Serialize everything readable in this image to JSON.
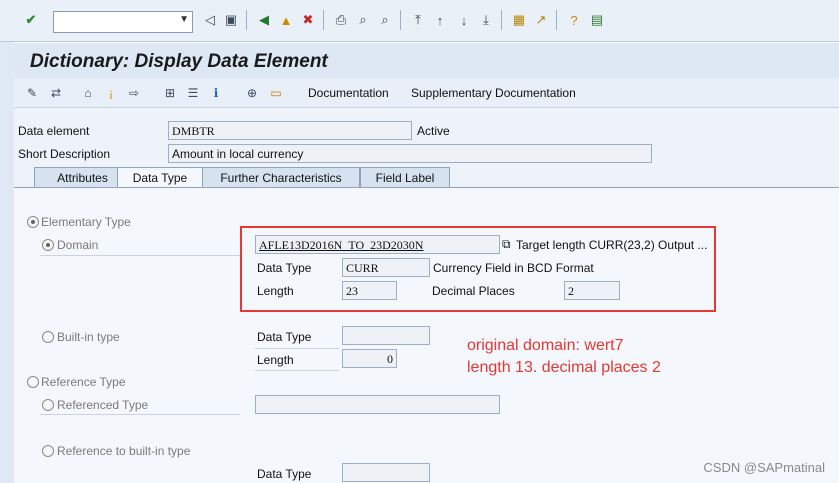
{
  "toolbar": {
    "icons": [
      "enter-icon",
      "back-icon",
      "save-icon",
      "nav-back-icon",
      "nav-exit-icon",
      "nav-cancel-icon",
      "print-icon",
      "find-icon",
      "find-next-icon",
      "first-page-icon",
      "prev-page-icon",
      "next-page-icon",
      "last-page-icon",
      "create-session-icon",
      "shortcut-icon",
      "help-icon",
      "customize-icon"
    ]
  },
  "title": "Dictionary: Display Data Element",
  "apptoolbar": {
    "documentation": "Documentation",
    "supplementary": "Supplementary Documentation"
  },
  "header": {
    "data_element_label": "Data element",
    "data_element_value": "DMBTR",
    "status": "Active",
    "short_desc_label": "Short Description",
    "short_desc_value": "Amount in local currency"
  },
  "tabs": [
    "Attributes",
    "Data Type",
    "Further Characteristics",
    "Field Label"
  ],
  "datatype": {
    "elementary_type": "Elementary Type",
    "domain_label": "Domain",
    "domain_value": "AFLE13D2016N_TO_23D2030N",
    "domain_desc": "Target length CURR(23,2) Output ...",
    "data_type_label": "Data Type",
    "data_type_value": "CURR",
    "data_type_desc": "Currency Field in BCD Format",
    "length_label": "Length",
    "length_value": "23",
    "decimal_label": "Decimal Places",
    "decimal_value": "2",
    "builtin_label": "Built-in type",
    "builtin_data_type_label": "Data Type",
    "builtin_data_type_value": "",
    "builtin_length_label": "Length",
    "builtin_length_value": "0",
    "reference_type": "Reference Type",
    "referenced_type": "Referenced Type",
    "ref_builtin": "Reference to built-in type",
    "ref_data_type_label": "Data Type"
  },
  "annotation": {
    "line1": "original domain: wert7",
    "line2": "length 13.  decimal places 2"
  },
  "watermark": "CSDN @SAPmatinal",
  "colors": {
    "annotation": "#e53935"
  }
}
